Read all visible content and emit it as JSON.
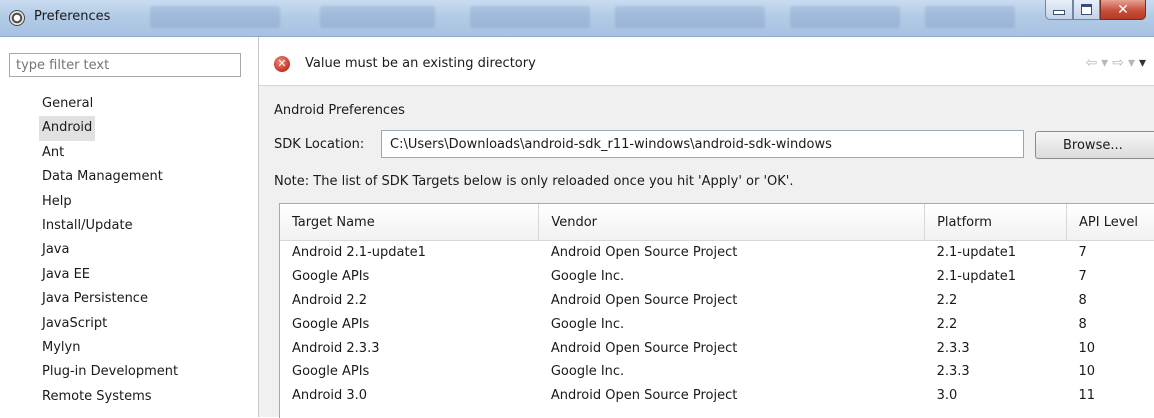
{
  "window": {
    "title": "Preferences"
  },
  "sidebar": {
    "filter_placeholder": "type filter text",
    "items": [
      {
        "label": "General"
      },
      {
        "label": "Android",
        "selected": true
      },
      {
        "label": "Ant"
      },
      {
        "label": "Data Management"
      },
      {
        "label": "Help"
      },
      {
        "label": "Install/Update"
      },
      {
        "label": "Java"
      },
      {
        "label": "Java EE"
      },
      {
        "label": "Java Persistence"
      },
      {
        "label": "JavaScript"
      },
      {
        "label": "Mylyn"
      },
      {
        "label": "Plug-in Development"
      },
      {
        "label": "Remote Systems"
      }
    ]
  },
  "message": {
    "icon": "error-icon",
    "text": "Value must be an existing directory"
  },
  "main": {
    "section_title": "Android Preferences",
    "sdk_label": "SDK Location:",
    "sdk_value": "C:\\Users\\Downloads\\android-sdk_r11-windows\\android-sdk-windows",
    "browse_label": "Browse...",
    "note": "Note: The list of SDK Targets below is only reloaded once you hit 'Apply' or 'OK'."
  },
  "table": {
    "headers": [
      "Target Name",
      "Vendor",
      "Platform",
      "API Level"
    ],
    "rows": [
      [
        "Android 2.1-update1",
        "Android Open Source Project",
        "2.1-update1",
        "7"
      ],
      [
        "Google APIs",
        "Google Inc.",
        "2.1-update1",
        "7"
      ],
      [
        "Android 2.2",
        "Android Open Source Project",
        "2.2",
        "8"
      ],
      [
        "Google APIs",
        "Google Inc.",
        "2.2",
        "8"
      ],
      [
        "Android 2.3.3",
        "Android Open Source Project",
        "2.3.3",
        "10"
      ],
      [
        "Google APIs",
        "Google Inc.",
        "2.3.3",
        "10"
      ],
      [
        "Android 3.0",
        "Android Open Source Project",
        "3.0",
        "11"
      ]
    ]
  },
  "colors": {
    "title_bar": "#b3cbe6",
    "close_button": "#c6503a",
    "error": "#c8311f",
    "selection": "#e1e1e1"
  }
}
